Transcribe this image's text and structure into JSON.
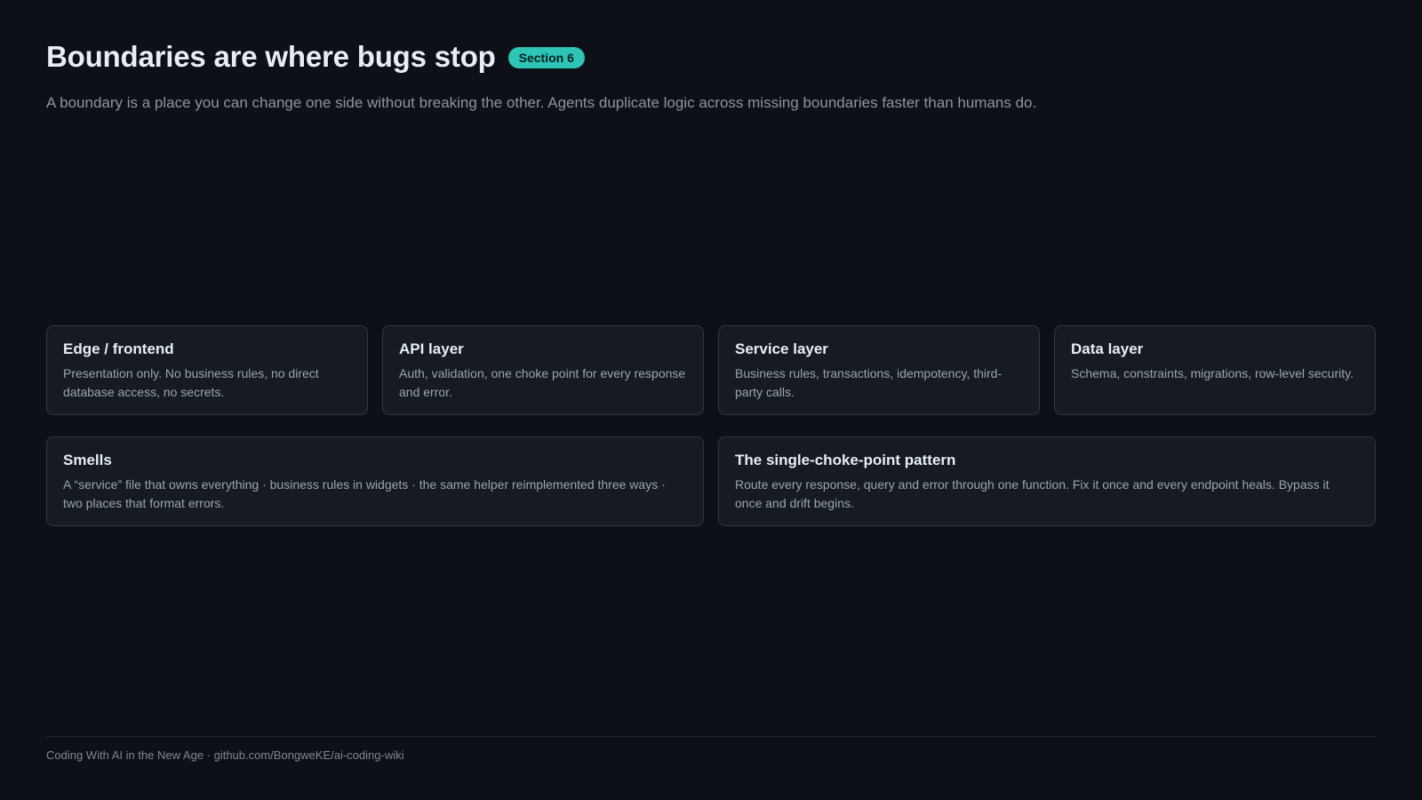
{
  "slide": {
    "title": "Boundaries are where bugs stop",
    "badge": "Section 6",
    "subtitle": "A boundary is a place you can change one side without breaking the other. Agents duplicate logic across missing boundaries faster than humans do."
  },
  "layers": [
    {
      "title": "Edge / frontend",
      "text": "Presentation only. No business rules, no direct database access, no secrets."
    },
    {
      "title": "API layer",
      "text": "Auth, validation, one choke point for every response and error."
    },
    {
      "title": "Service layer",
      "text": "Business rules, transactions, idempotency, third-party calls."
    },
    {
      "title": "Data layer",
      "text": "Schema, constraints, migrations, row-level security."
    }
  ],
  "notes": [
    {
      "title": "Smells",
      "text": "A “service” file that owns everything · business rules in widgets · the same helper reimplemented three ways · two places that format errors."
    },
    {
      "title": "The single-choke-point pattern",
      "text": "Route every response, query and error through one function. Fix it once and every endpoint heals. Bypass it once and drift begins."
    }
  ],
  "footer": {
    "text": "Coding With AI in the New Age · github.com/BongweKE/ai-coding-wiki"
  },
  "colors": {
    "background": "#0d1117",
    "card": "#161b22",
    "border": "#30363d",
    "accent": "#2ec4b6"
  }
}
